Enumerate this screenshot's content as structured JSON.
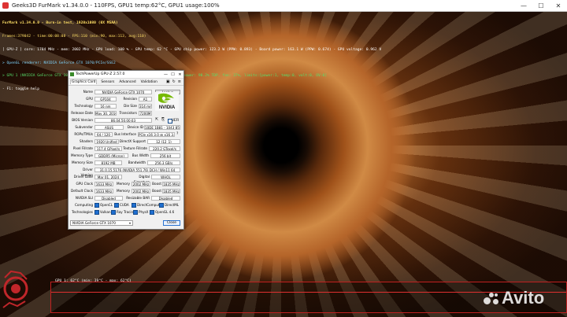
{
  "window": {
    "title": "Geeks3D FurMark v1.34.0.0 - 110FPS, GPU1 temp:62°C, GPU1 usage:100%",
    "controls": [
      "—",
      "☐",
      "✕"
    ]
  },
  "osd": {
    "lines": [
      {
        "text": "FurMark v1.34.0.0 - Burn-in test, 1920x1080 (0X MSAA)",
        "color": "#ffe066"
      },
      {
        "text": "Frames:379042 - time:00:08:08 - FPS:110 (min:90, max:113, avg:110)",
        "color": "#ffe066"
      },
      {
        "text": "[ GPU-Z ] core: 1784 MHz - mem: 2002 MHz - GPU load: 100 % - GPU temp: 62 °C - GPU chip power: 123.2 W (PPW: 0.893) - Board power: 163.1 W (PPW: 0.674) - GPU voltage: 0.962 V",
        "color": "#ffffff"
      },
      {
        "text": "> OpenGL renderer: NVIDIA GeForce GTX 1070/PCIe/SSE2",
        "color": "#7fd6ff"
      },
      {
        "text": "> GPU 1 (NVIDIA GeForce GTX 1070) - core: 1784MHz/62°C/100%, mem: 4008MHz/12%, GPU power: 98.2% TDP, fan: 37%, limits:[power:1, temp:0, volt:0, OV:0]",
        "color": "#57e06b"
      },
      {
        "text": "- F1: toggle help",
        "color": "#ffffff"
      }
    ]
  },
  "gpuz": {
    "title": "TechPowerUp GPU-Z 2.57.0",
    "tabs": [
      "Graphics Card",
      "Sensors",
      "Advanced",
      "Validation"
    ],
    "toolbar_icons": [
      "camera-icon",
      "refresh-icon",
      "menu-icon"
    ],
    "name_label": "Name",
    "name_value": "NVIDIA GeForce GTX 1070",
    "lookup": "Lookup",
    "gpu_label": "GPU",
    "gpu_value": "GP104",
    "revision_label": "Revision",
    "revision_value": "A1",
    "tech_label": "Technology",
    "tech_value": "16 nm",
    "diesize_label": "Die Size",
    "diesize_value": "314 mm²",
    "release_label": "Release Date",
    "release_value": "May 30, 2016",
    "transistors_label": "Transistors",
    "transistors_value": "7200M",
    "bios_label": "BIOS Version",
    "bios_value": "86.04.50.00.63",
    "uefi_label": "UEFI",
    "subvendor_label": "Subvendor",
    "subvendor_value": "ASUS",
    "deviceid_label": "Device ID",
    "deviceid_value": "10DE 1B81 - 1043 8599",
    "rops_label": "ROPs/TMUs",
    "rops_value": "64 / 120",
    "bus_label": "Bus Interface",
    "bus_value": "PCIe x16 3.0 @ x16 3.0",
    "shaders_label": "Shaders",
    "shaders_value": "1920 Unified",
    "dx_label": "DirectX Support",
    "dx_value": "12 (12_1)",
    "pixel_label": "Pixel Fillrate",
    "pixel_value": "117.4 GPixel/s",
    "texture_label": "Texture Fillrate",
    "texture_value": "220.2 GTexel/s",
    "memtype_label": "Memory Type",
    "memtype_value": "GDDR5 (Micron)",
    "buswidth_label": "Bus Width",
    "buswidth_value": "256 bit",
    "memsize_label": "Memory Size",
    "memsize_value": "8192 MB",
    "bandwidth_label": "Bandwidth",
    "bandwidth_value": "256.3 GB/s",
    "driver_label": "Driver Version",
    "driver_value": "31.0.15.5176 (NVIDIA 551.76) DCH / Win11 64",
    "driverdate_label": "Driver Date",
    "driverdate_value": "Mar 01, 2024",
    "digsig_label": "Digital Signature",
    "digsig_value": "WHQL",
    "gpuclock_label": "GPU Clock",
    "gpuclock_value": "1633 MHz",
    "memory_label": "Memory",
    "memory_value": "2002 MHz",
    "boost_label": "Boost",
    "boost_value": "1835 MHz",
    "defclock_label": "Default Clock",
    "defclock_value": "1633 MHz",
    "defmemory_value": "2002 MHz",
    "defboost_value": "1835 MHz",
    "sli_label": "NVIDIA SLI",
    "sli_value": "Disabled",
    "rebar_label": "Resizable BAR",
    "rebar_value": "Disabled",
    "computing_label": "Computing",
    "computing": [
      "OpenCL",
      "CUDA",
      "DirectCompute",
      "DirectML"
    ],
    "technologies_label": "Technologies",
    "technologies": [
      "Vulkan",
      "Ray Tracing",
      "PhysX",
      "OpenGL 4.6"
    ],
    "card_select": "NVIDIA GeForce GTX 1070",
    "close": "Close",
    "nvidia": "NVIDIA"
  },
  "graph": {
    "label": "GPU 1: 62°C (min: 39°C - max: 62°C)",
    "line_color": "#e03030"
  },
  "watermark": "Avito"
}
